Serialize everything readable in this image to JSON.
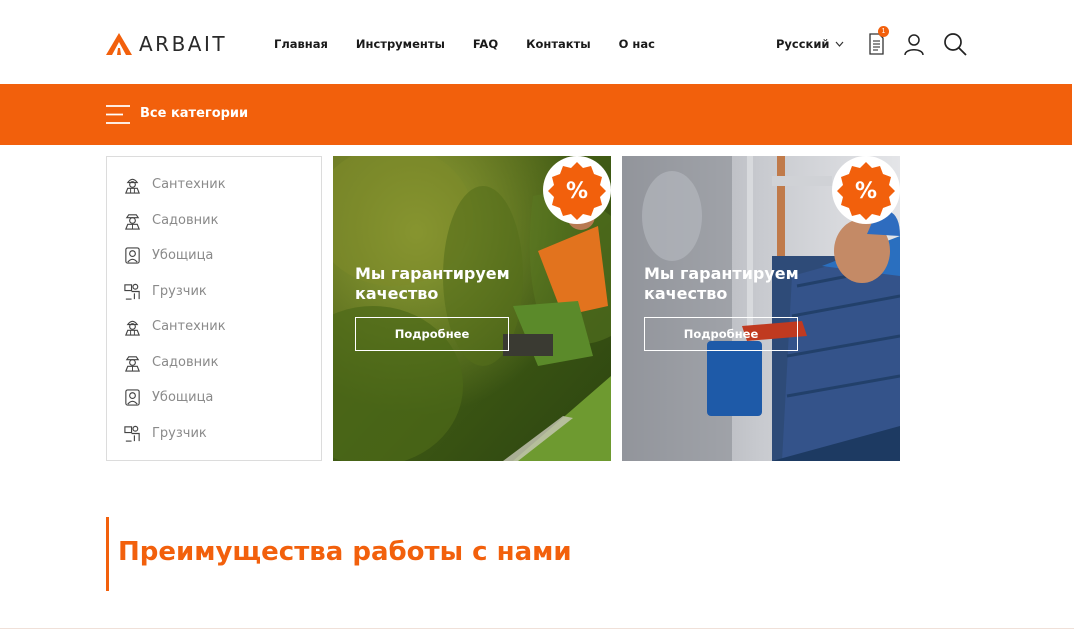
{
  "brand": {
    "name": "ARBAIT",
    "accent": "#f2600c"
  },
  "nav": {
    "items": [
      {
        "label": "Главная"
      },
      {
        "label": "Инструменты"
      },
      {
        "label": "FAQ"
      },
      {
        "label": "Контакты"
      },
      {
        "label": "О нас"
      }
    ]
  },
  "header": {
    "language": "Русский",
    "cart_count": "1",
    "icons": [
      "document-icon",
      "user-icon",
      "search-icon"
    ]
  },
  "category_bar": {
    "label": "Все категории",
    "icon": "menu-icon"
  },
  "categories": [
    {
      "label": "Сантехник",
      "icon": "plumber-icon"
    },
    {
      "label": "Садовник",
      "icon": "gardener-icon"
    },
    {
      "label": "Убощица",
      "icon": "cleaner-icon"
    },
    {
      "label": "Грузчик",
      "icon": "loader-icon"
    },
    {
      "label": "Сантехник",
      "icon": "plumber-icon"
    },
    {
      "label": "Садовник",
      "icon": "gardener-icon"
    },
    {
      "label": "Убощица",
      "icon": "cleaner-icon"
    },
    {
      "label": "Грузчик",
      "icon": "loader-icon"
    }
  ],
  "promos": [
    {
      "title": "Мы гарантируем качество",
      "button": "Подробнее",
      "badge": "%",
      "image": "gardener-photo"
    },
    {
      "title": "Мы гарантируем качество",
      "button": "Подробнее",
      "badge": "%",
      "image": "plumber-photo"
    }
  ],
  "advantages": {
    "title": "Преимущества работы с нами"
  }
}
